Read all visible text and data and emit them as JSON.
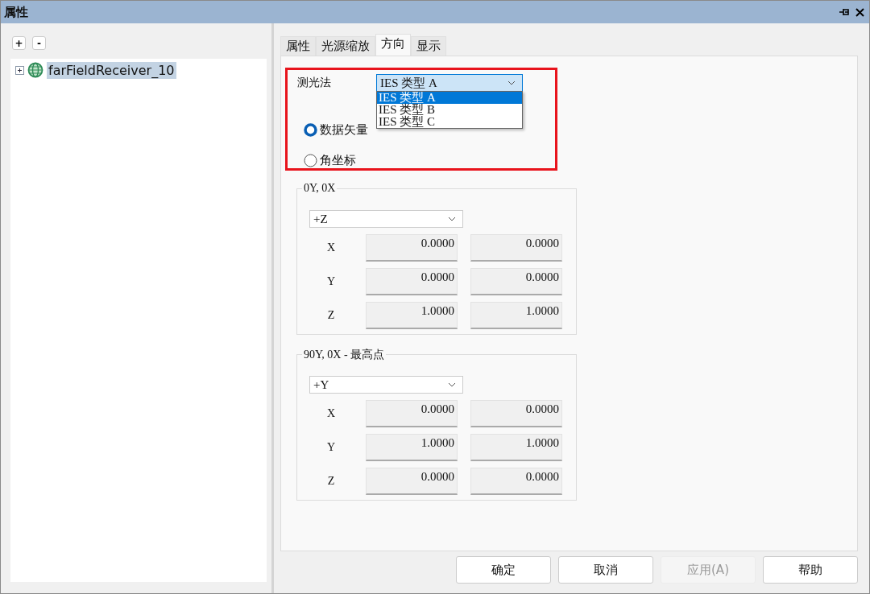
{
  "window": {
    "title": "属性"
  },
  "tree_toolbar": [
    "+",
    "-"
  ],
  "tree": [
    {
      "label": "farFieldReceiver_10",
      "selected": true,
      "expanded": false
    }
  ],
  "tabs": [
    {
      "label": "属性",
      "selected": false
    },
    {
      "label": "光源缩放",
      "selected": false
    },
    {
      "label": "方向",
      "selected": true
    },
    {
      "label": "显示",
      "selected": false
    }
  ],
  "photometry": {
    "label": "测光法",
    "value": "IES 类型 A",
    "open": true,
    "options": [
      {
        "label": "IES 类型 A",
        "selected": true
      },
      {
        "label": "IES 类型 B",
        "selected": false
      },
      {
        "label": "IES 类型 C",
        "selected": false
      }
    ]
  },
  "radios": [
    {
      "label": "数据矢量",
      "selected": true
    },
    {
      "label": "角坐标",
      "selected": false
    }
  ],
  "groups": [
    {
      "title": "0Y, 0X",
      "direction": "+Z",
      "rows": [
        {
          "axis": "X",
          "values": [
            "0.0000",
            "0.0000"
          ]
        },
        {
          "axis": "Y",
          "values": [
            "0.0000",
            "0.0000"
          ]
        },
        {
          "axis": "Z",
          "values": [
            "1.0000",
            "1.0000"
          ]
        }
      ]
    },
    {
      "title": "90Y, 0X - 最高点",
      "direction": "+Y",
      "rows": [
        {
          "axis": "X",
          "values": [
            "0.0000",
            "0.0000"
          ]
        },
        {
          "axis": "Y",
          "values": [
            "1.0000",
            "1.0000"
          ]
        },
        {
          "axis": "Z",
          "values": [
            "0.0000",
            "0.0000"
          ]
        }
      ]
    }
  ],
  "buttons": [
    {
      "label": "确定",
      "disabled": false
    },
    {
      "label": "取消",
      "disabled": false
    },
    {
      "label": "应用(A)",
      "disabled": true
    },
    {
      "label": "帮助",
      "disabled": false
    }
  ]
}
